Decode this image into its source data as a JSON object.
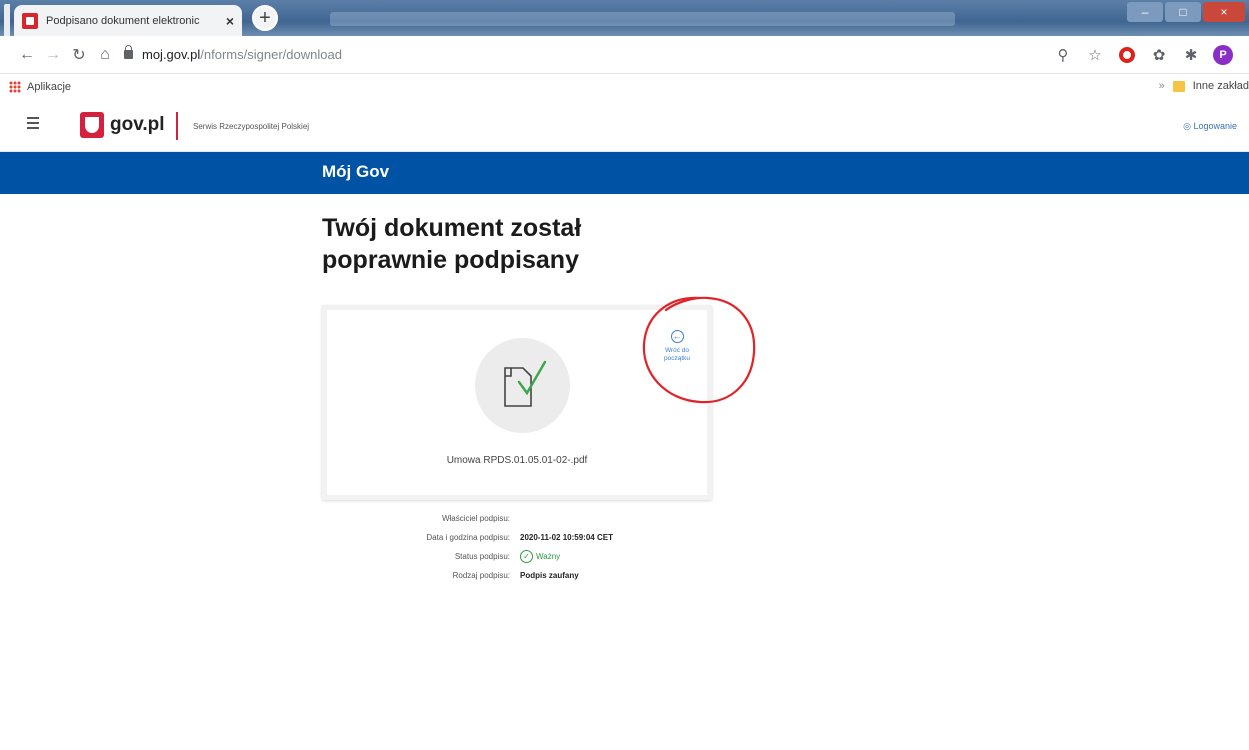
{
  "browser": {
    "tab_title": "Podpisano dokument elektronic",
    "tab_close": "×",
    "new_tab": "+",
    "url_host": "moj.gov.pl",
    "url_path": "/nforms/signer/download",
    "bookmarks": {
      "apps_label": "Aplikacje",
      "overflow": "»",
      "other_label": "Inne zakład"
    },
    "profile_initial": "P"
  },
  "header": {
    "logo_text": "gov.pl",
    "service_name": "Serwis Rzeczypospolitej Polskiej",
    "login": "Logowanie"
  },
  "brand_bar": {
    "title": "Mój Gov"
  },
  "main": {
    "title_line1": "Twój dokument został",
    "title_line2": "poprawnie podpisany",
    "card": {
      "file_name": "Umowa RPDS.01.05.01-02-.pdf",
      "back_line1": "Wróć do",
      "back_line2": "początku"
    },
    "meta": [
      {
        "label": "Właściciel podpisu:",
        "value": ""
      },
      {
        "label": "Data i godzina podpisu:",
        "value": "2020-11-02 10:59:04 CET"
      },
      {
        "label": "Status podpisu:",
        "value": "Ważny"
      },
      {
        "label": "Rodzaj podpisu:",
        "value": "Podpis zaufany"
      }
    ]
  },
  "colors": {
    "brand_blue": "#0052a5",
    "gov_red": "#d4213d",
    "valid_green": "#2e9a44",
    "annotation_red": "#e0242a"
  }
}
